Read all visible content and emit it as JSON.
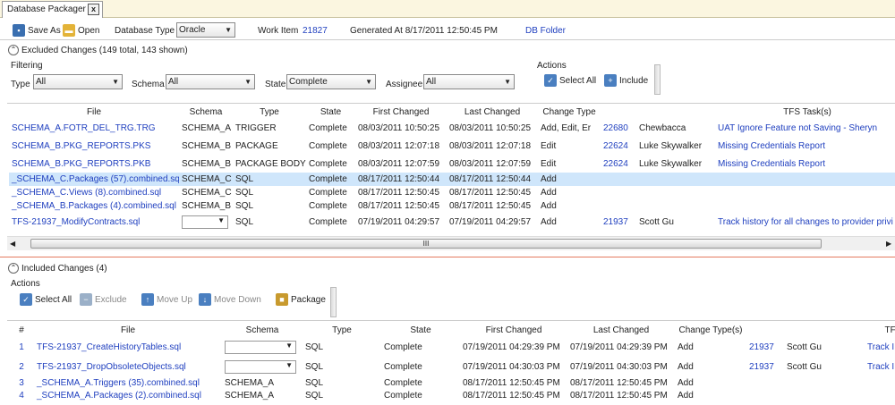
{
  "tab": {
    "title": "Database Packager",
    "close": "x"
  },
  "toolbar": {
    "save_as": "Save As",
    "open": "Open",
    "db_type_label": "Database Type",
    "db_type_value": "Oracle",
    "work_item_label": "Work Item",
    "work_item_value": "21827",
    "generated": "Generated At 8/17/2011 12:50:45 PM",
    "db_folder": "DB Folder"
  },
  "excluded": {
    "header": "Excluded Changes (149 total,  143 shown)",
    "filtering": "Filtering",
    "type_label": "Type",
    "type_value": "All",
    "schema_label": "Schema",
    "schema_value": "All",
    "state_label": "State",
    "state_value": "Complete",
    "assignee_label": "Assignee",
    "assignee_value": "All",
    "actions": "Actions",
    "select_all": "Select All",
    "include": "Include",
    "columns": [
      "File",
      "Schema",
      "Type",
      "State",
      "First Changed",
      "Last Changed",
      "Change Type",
      "",
      "",
      "TFS Task(s)"
    ],
    "rows": [
      [
        "SCHEMA_A.FOTR_DEL_TRG.TRG",
        "SCHEMA_A",
        "TRIGGER",
        "Complete",
        "08/03/2011 10:50:25",
        "08/03/2011 10:50:25",
        "Add, Edit, Er",
        "22680",
        "Chewbacca",
        "UAT Ignore Feature not Saving - Sheryn"
      ],
      [
        "SCHEMA_B.PKG_REPORTS.PKS",
        "SCHEMA_B",
        "PACKAGE",
        "Complete",
        "08/03/2011 12:07:18",
        "08/03/2011 12:07:18",
        "Edit",
        "22624",
        "Luke Skywalker",
        "Missing Credentials Report"
      ],
      [
        "SCHEMA_B.PKG_REPORTS.PKB",
        "SCHEMA_B",
        "PACKAGE BODY",
        "Complete",
        "08/03/2011 12:07:59",
        "08/03/2011 12:07:59",
        "Edit",
        "22624",
        "Luke Skywalker",
        "Missing Credentials Report"
      ],
      [
        "_SCHEMA_C.Packages (57).combined.sql",
        "SCHEMA_C",
        "SQL",
        "Complete",
        "08/17/2011 12:50:44",
        "08/17/2011 12:50:44",
        "Add",
        "",
        "",
        ""
      ],
      [
        "_SCHEMA_C.Views (8).combined.sql",
        "SCHEMA_C",
        "SQL",
        "Complete",
        "08/17/2011 12:50:45",
        "08/17/2011 12:50:45",
        "Add",
        "",
        "",
        ""
      ],
      [
        "_SCHEMA_B.Packages (4).combined.sql",
        "SCHEMA_B",
        "SQL",
        "Complete",
        "08/17/2011 12:50:45",
        "08/17/2011 12:50:45",
        "Add",
        "",
        "",
        ""
      ],
      [
        "TFS-21937_ModifyContracts.sql",
        "",
        "SQL",
        "Complete",
        "07/19/2011 04:29:57",
        "07/19/2011 04:29:57",
        "Add",
        "21937",
        "Scott Gu",
        "Track history for all changes to provider privi"
      ]
    ],
    "scroll_grip": "III"
  },
  "included": {
    "header": "Included Changes (4)",
    "actions": "Actions",
    "select_all": "Select All",
    "exclude": "Exclude",
    "move_up": "Move Up",
    "move_down": "Move Down",
    "package": "Package",
    "columns": [
      "#",
      "File",
      "Schema",
      "Type",
      "State",
      "First Changed",
      "Last Changed",
      "Change Type(s)",
      "",
      "",
      "TFS"
    ],
    "rows": [
      [
        "1",
        "TFS-21937_CreateHistoryTables.sql",
        "",
        "SQL",
        "Complete",
        "07/19/2011 04:29:39 PM",
        "07/19/2011 04:29:39 PM",
        "Add",
        "21937",
        "Scott Gu",
        "Track I"
      ],
      [
        "2",
        "TFS-21937_DropObsoleteObjects.sql",
        "",
        "SQL",
        "Complete",
        "07/19/2011 04:30:03 PM",
        "07/19/2011 04:30:03 PM",
        "Add",
        "21937",
        "Scott Gu",
        "Track I"
      ],
      [
        "3",
        "_SCHEMA_A.Triggers (35).combined.sql",
        "SCHEMA_A",
        "SQL",
        "Complete",
        "08/17/2011 12:50:45 PM",
        "08/17/2011 12:50:45 PM",
        "Add",
        "",
        "",
        ""
      ],
      [
        "4",
        "_SCHEMA_A.Packages (2).combined.sql",
        "SCHEMA_A",
        "SQL",
        "Complete",
        "08/17/2011 12:50:45 PM",
        "08/17/2011 12:50:45 PM",
        "Add",
        "",
        "",
        ""
      ]
    ]
  }
}
